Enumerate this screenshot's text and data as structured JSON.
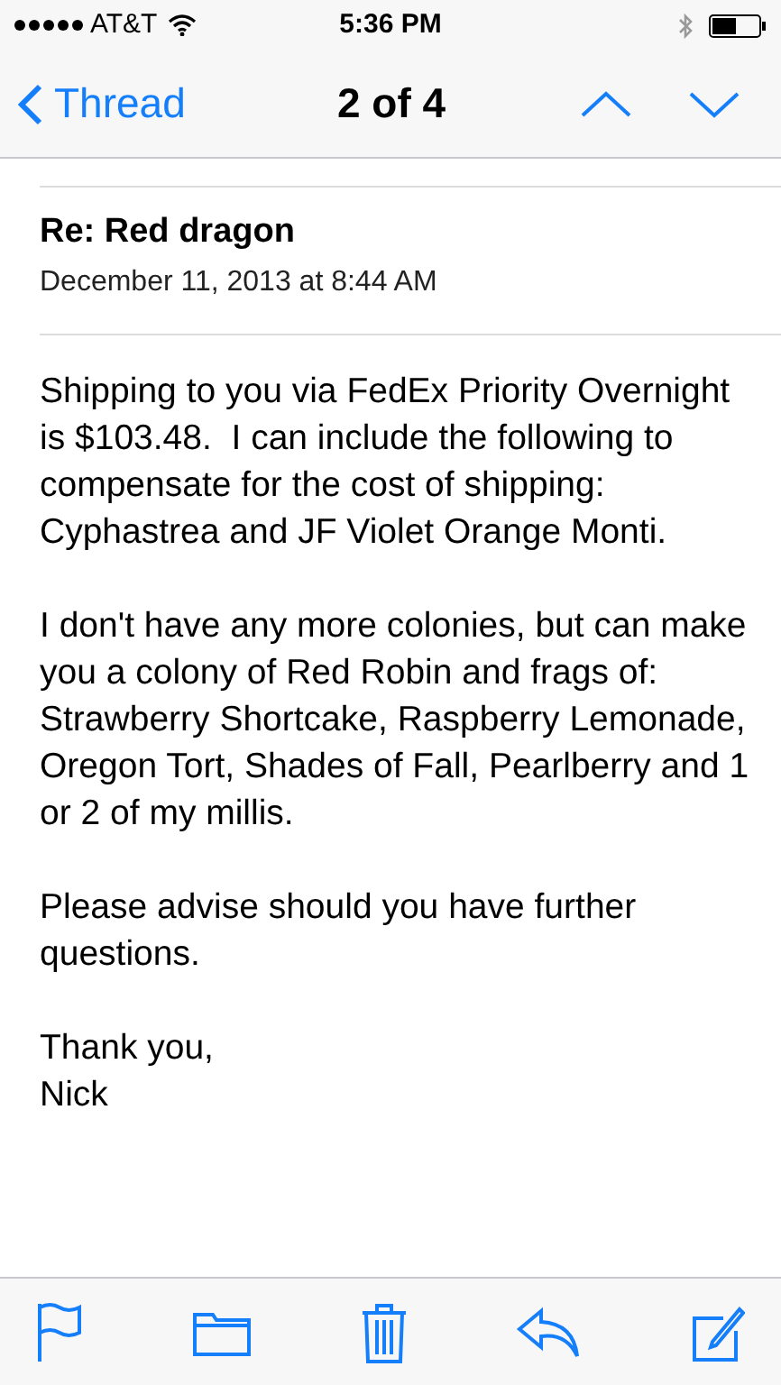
{
  "status_bar": {
    "carrier": "AT&T",
    "time": "5:36 PM"
  },
  "nav_bar": {
    "back": "Thread",
    "position": "2 of 4"
  },
  "message": {
    "subject": "Re: Red dragon",
    "date": "December 11, 2013 at 8:44 AM",
    "paragraphs": [
      "Shipping to you via FedEx Priority Overnight is $103.48.  I can include the following to compensate for the cost of shipping: Cyphastrea and JF Violet Orange Monti.",
      "I don't have any more colonies, but can make you a colony of Red Robin and frags of: Strawberry Shortcake, Raspberry Lemonade, Oregon Tort, Shades of Fall, Pearlberry and 1 or 2 of my millis.",
      "Please advise should you have further questions.",
      "Thank you,\nNick"
    ]
  },
  "toolbar": [
    {
      "kind": "flag"
    },
    {
      "kind": "folder"
    },
    {
      "kind": "trash"
    },
    {
      "kind": "reply"
    },
    {
      "kind": "compose"
    }
  ]
}
